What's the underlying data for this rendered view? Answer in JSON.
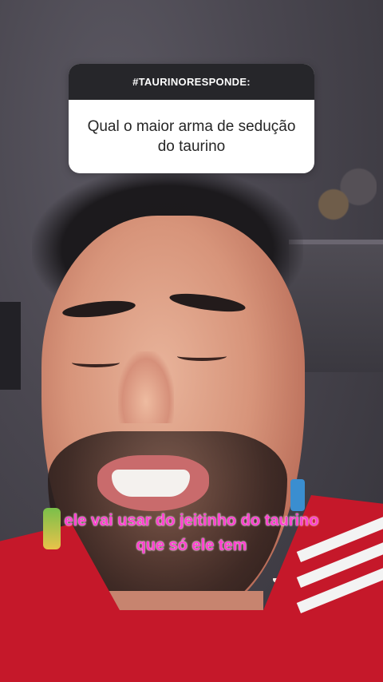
{
  "question_box": {
    "header": "#TAURINORESPONDE:",
    "question_line1": "Qual o maior arma de sedução",
    "question_line2": "do taurino"
  },
  "captions": {
    "line1": "ele vai usar do jeitinho do taurino",
    "line2": "que só ele tem"
  },
  "colors": {
    "caption_text": "#ff3fcf",
    "card_header_bg": "#26262a",
    "card_body_bg": "#ffffff",
    "shirt": "#c5182a"
  }
}
